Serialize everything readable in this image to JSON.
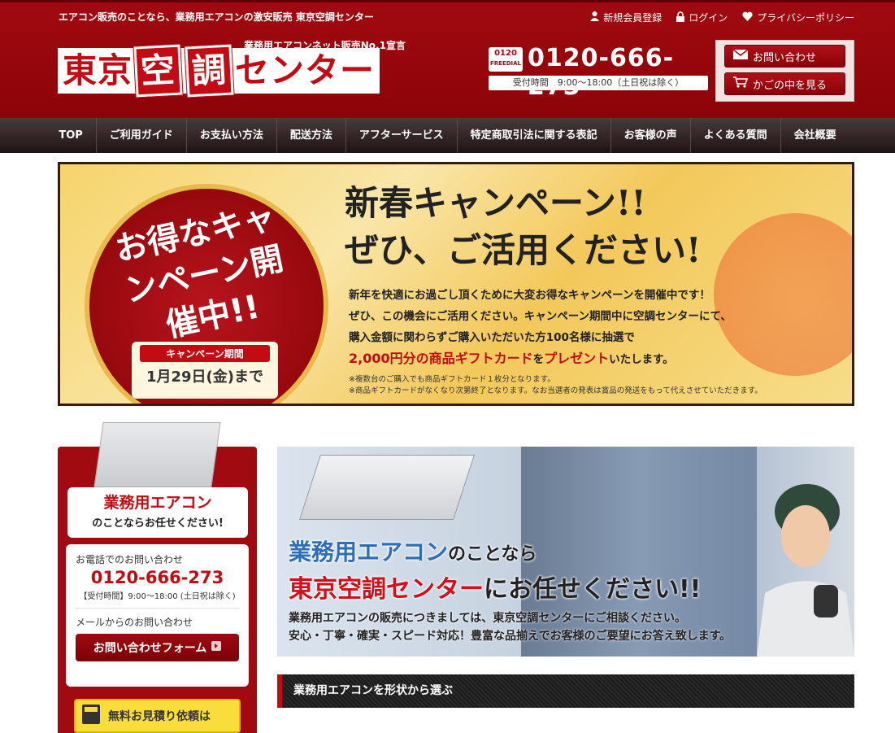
{
  "header": {
    "tagline": "エアコン販売のことなら、業務用エアコンの激安販売 東京空調センター",
    "links": [
      {
        "icon": "person-icon",
        "label": "新規会員登録"
      },
      {
        "icon": "lock-icon",
        "label": "ログイン"
      },
      {
        "icon": "heart-icon",
        "label": "プライバシーポリシー"
      }
    ],
    "logo_sub": "業務用エアコンネット販売No.1宣言",
    "logo_parts": [
      "東京",
      "空",
      "調",
      "センター"
    ],
    "freedial_top": "0120",
    "freedial_bottom": "FREEDIAL",
    "phone": "0120-666-273",
    "hours": "受付時間　9:00〜18:00（土日祝は除く）",
    "btn_contact": "お問い合わせ",
    "btn_cart": "かごの中を見る"
  },
  "nav": [
    "TOP",
    "ご利用ガイド",
    "お支払い方法",
    "配送方法",
    "アフターサービス",
    "特定商取引法に関する表記",
    "お客様の声",
    "よくある質問",
    "会社概要"
  ],
  "banner": {
    "circle_text": "お得なキャンペーン開催中!!",
    "period_label": "キャンペーン期間",
    "period_date": "1月29日(金)まで",
    "headline1": "新春キャンペーン!!",
    "headline2": "ぜひ、ご活用ください!",
    "line1": "新年を快適にお過ごし頂くために大変お得なキャンペーンを開催中です！",
    "line2": "ぜひ、この機会にご活用ください。キャンペーン期間中に空調センターにて、",
    "line3": "購入金額に関わらずご購入いただいた方100名様に抽選で",
    "line4_red1": "2,000円分の商品ギフトカード",
    "line4_mid": "を",
    "line4_red2": "プレゼント",
    "line4_end": "いたします。",
    "note1": "※複数台のご購入でも商品ギフトカード１枚分となります。",
    "note2": "※商品ギフトカードがなくなり次第終了となります。なお当選者の発表は賞品の発送をもって代えさせていただきます。"
  },
  "sidebar": {
    "title1": "業務用エアコン",
    "title2": "のことならお任せください!",
    "phone_label": "お電話でのお問い合わせ",
    "phone": "0120-666-273",
    "hours": "【受付時間】9:00〜18:00 (土日祝は除く)",
    "mail_label": "メールからのお問い合わせ",
    "form_button": "お問い合わせフォーム",
    "estimate": "無料お見積り依頼は"
  },
  "hero": {
    "h1_main": "業務用エアコン",
    "h1_rest": "のことなら",
    "h2_main": "東京空調センター",
    "h2_rest": "にお任せください!!",
    "p1": "業務用エアコンの販売につきましては、東京空調センターにご相談ください。",
    "p2": "安心・丁寧・確実・スピード対応！豊富な品揃えでお客様のご要望にお答え致します。"
  },
  "section_title": "業務用エアコンを形状から選ぶ",
  "colors": {
    "brand_red": "#a00a10",
    "accent_red": "#c40a12",
    "nav_dark": "#2a1e1e"
  }
}
